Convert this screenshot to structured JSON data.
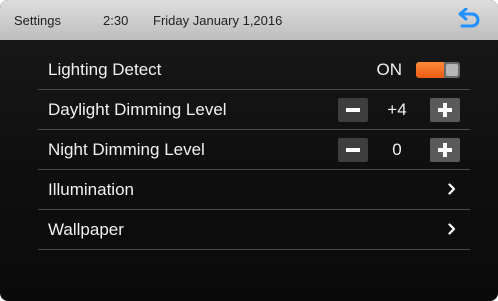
{
  "header": {
    "title": "Settings",
    "time": "2:30",
    "date": "Friday January 1,2016",
    "back_icon": "back-arrow-icon"
  },
  "settings": {
    "lighting_detect": {
      "label": "Lighting Detect",
      "state": "ON",
      "toggle_on": true
    },
    "daylight_dimming": {
      "label": "Daylight Dimming Level",
      "value": "+4"
    },
    "night_dimming": {
      "label": "Night Dimming Level",
      "value": "0"
    },
    "illumination": {
      "label": "Illumination"
    },
    "wallpaper": {
      "label": "Wallpaper"
    }
  },
  "colors": {
    "accent_orange": "#ea5a12",
    "back_icon_blue": "#1e90ff",
    "text_light": "#f1f1f1",
    "background_dark": "#121212"
  },
  "icons": {
    "minus": "minus-icon",
    "plus": "plus-icon",
    "chevron": "chevron-right-icon"
  }
}
